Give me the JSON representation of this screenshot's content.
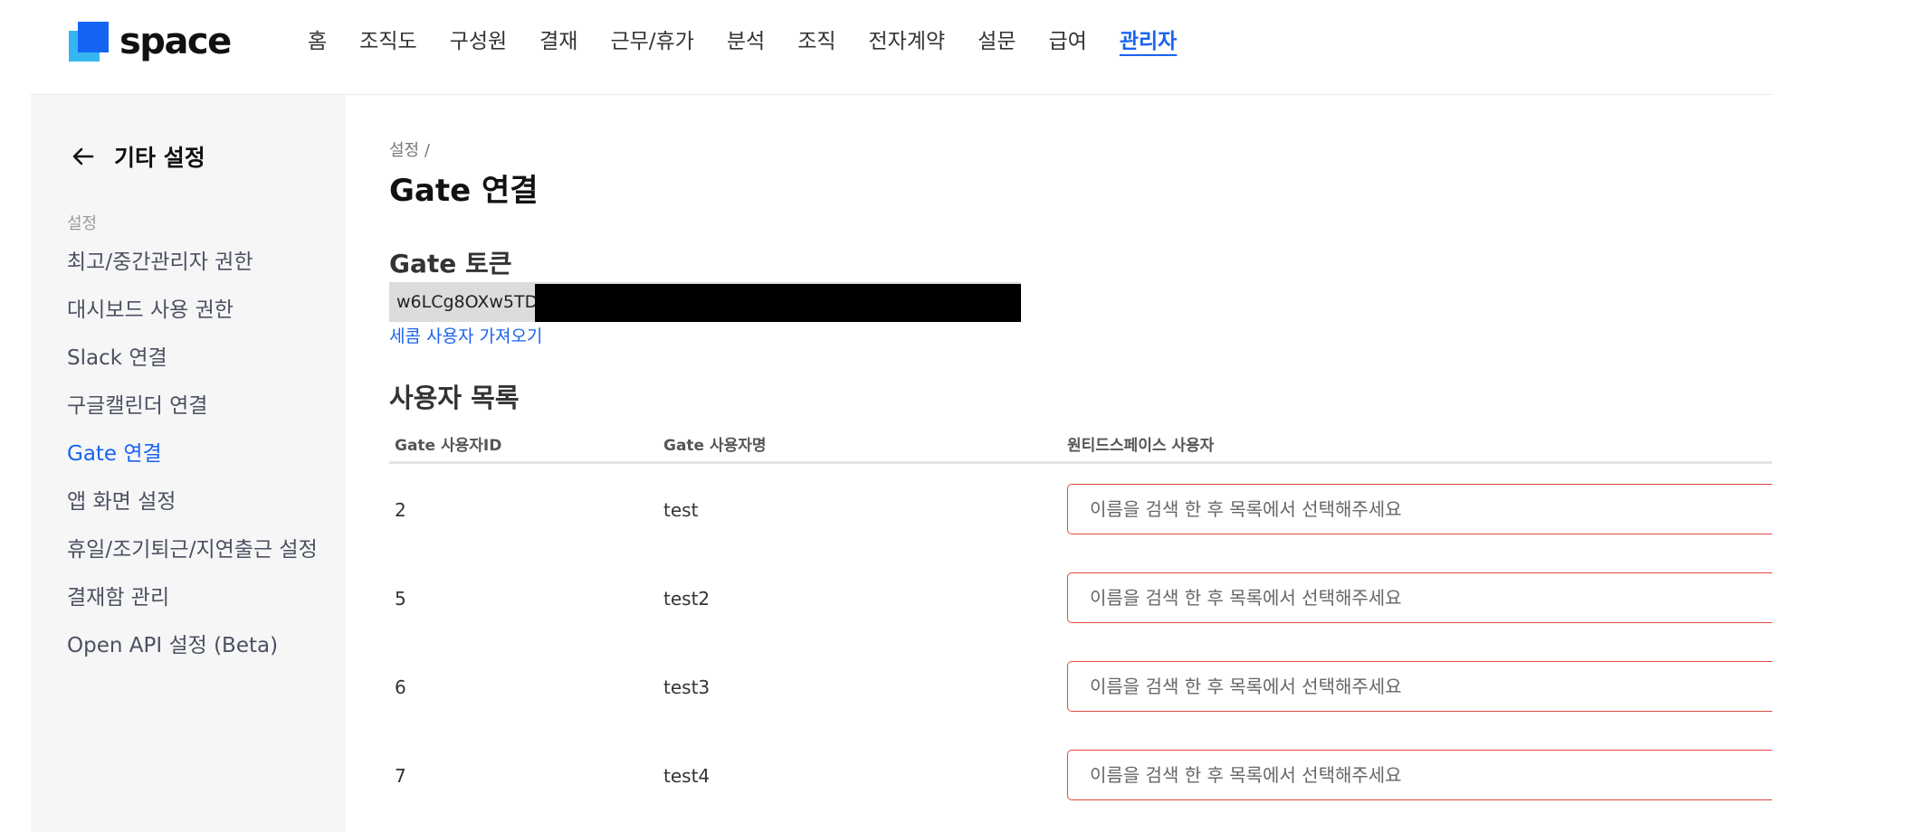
{
  "brand": {
    "name": "space",
    "colors": {
      "primary": "#1565f5",
      "secondary": "#36b6f0"
    }
  },
  "nav": {
    "items": [
      "홈",
      "조직도",
      "구성원",
      "결재",
      "근무/휴가",
      "분석",
      "조직",
      "전자계약",
      "설문",
      "급여",
      "관리자"
    ],
    "active": "관리자"
  },
  "sidebar": {
    "title": "기타 설정",
    "section_label": "설정",
    "items": [
      {
        "label": "최고/중간관리자 권한"
      },
      {
        "label": "대시보드 사용 권한"
      },
      {
        "label": "Slack 연결"
      },
      {
        "label": "구글캘린더 연결"
      },
      {
        "label": "Gate 연결",
        "active": true
      },
      {
        "label": "앱 화면 설정"
      },
      {
        "label": "휴일/조기퇴근/지연출근 설정"
      },
      {
        "label": "결재함 관리"
      },
      {
        "label": "Open API 설정 (Beta)"
      }
    ]
  },
  "main": {
    "breadcrumb": "설정 /",
    "title": "Gate 연결",
    "token": {
      "heading": "Gate 토큰",
      "value_visible": "w6LCg8OXw5TD"
    },
    "import_link": "세콤 사용자 가져오기",
    "users": {
      "heading": "사용자 목록",
      "columns": [
        "Gate 사용자ID",
        "Gate 사용자명",
        "원티드스페이스 사용자"
      ],
      "rows": [
        {
          "id": "2",
          "name": "test",
          "placeholder": "이름을 검색 한 후 목록에서 선택해주세요"
        },
        {
          "id": "5",
          "name": "test2",
          "placeholder": "이름을 검색 한 후 목록에서 선택해주세요"
        },
        {
          "id": "6",
          "name": "test3",
          "placeholder": "이름을 검색 한 후 목록에서 선택해주세요"
        },
        {
          "id": "7",
          "name": "test4",
          "placeholder": "이름을 검색 한 후 목록에서 선택해주세요"
        }
      ]
    }
  },
  "colors": {
    "accent": "#1a64f0",
    "error_border": "#e04a3f",
    "sidebar_bg": "#f6f6f7"
  },
  "icons": {
    "back": "arrow-left-icon"
  }
}
